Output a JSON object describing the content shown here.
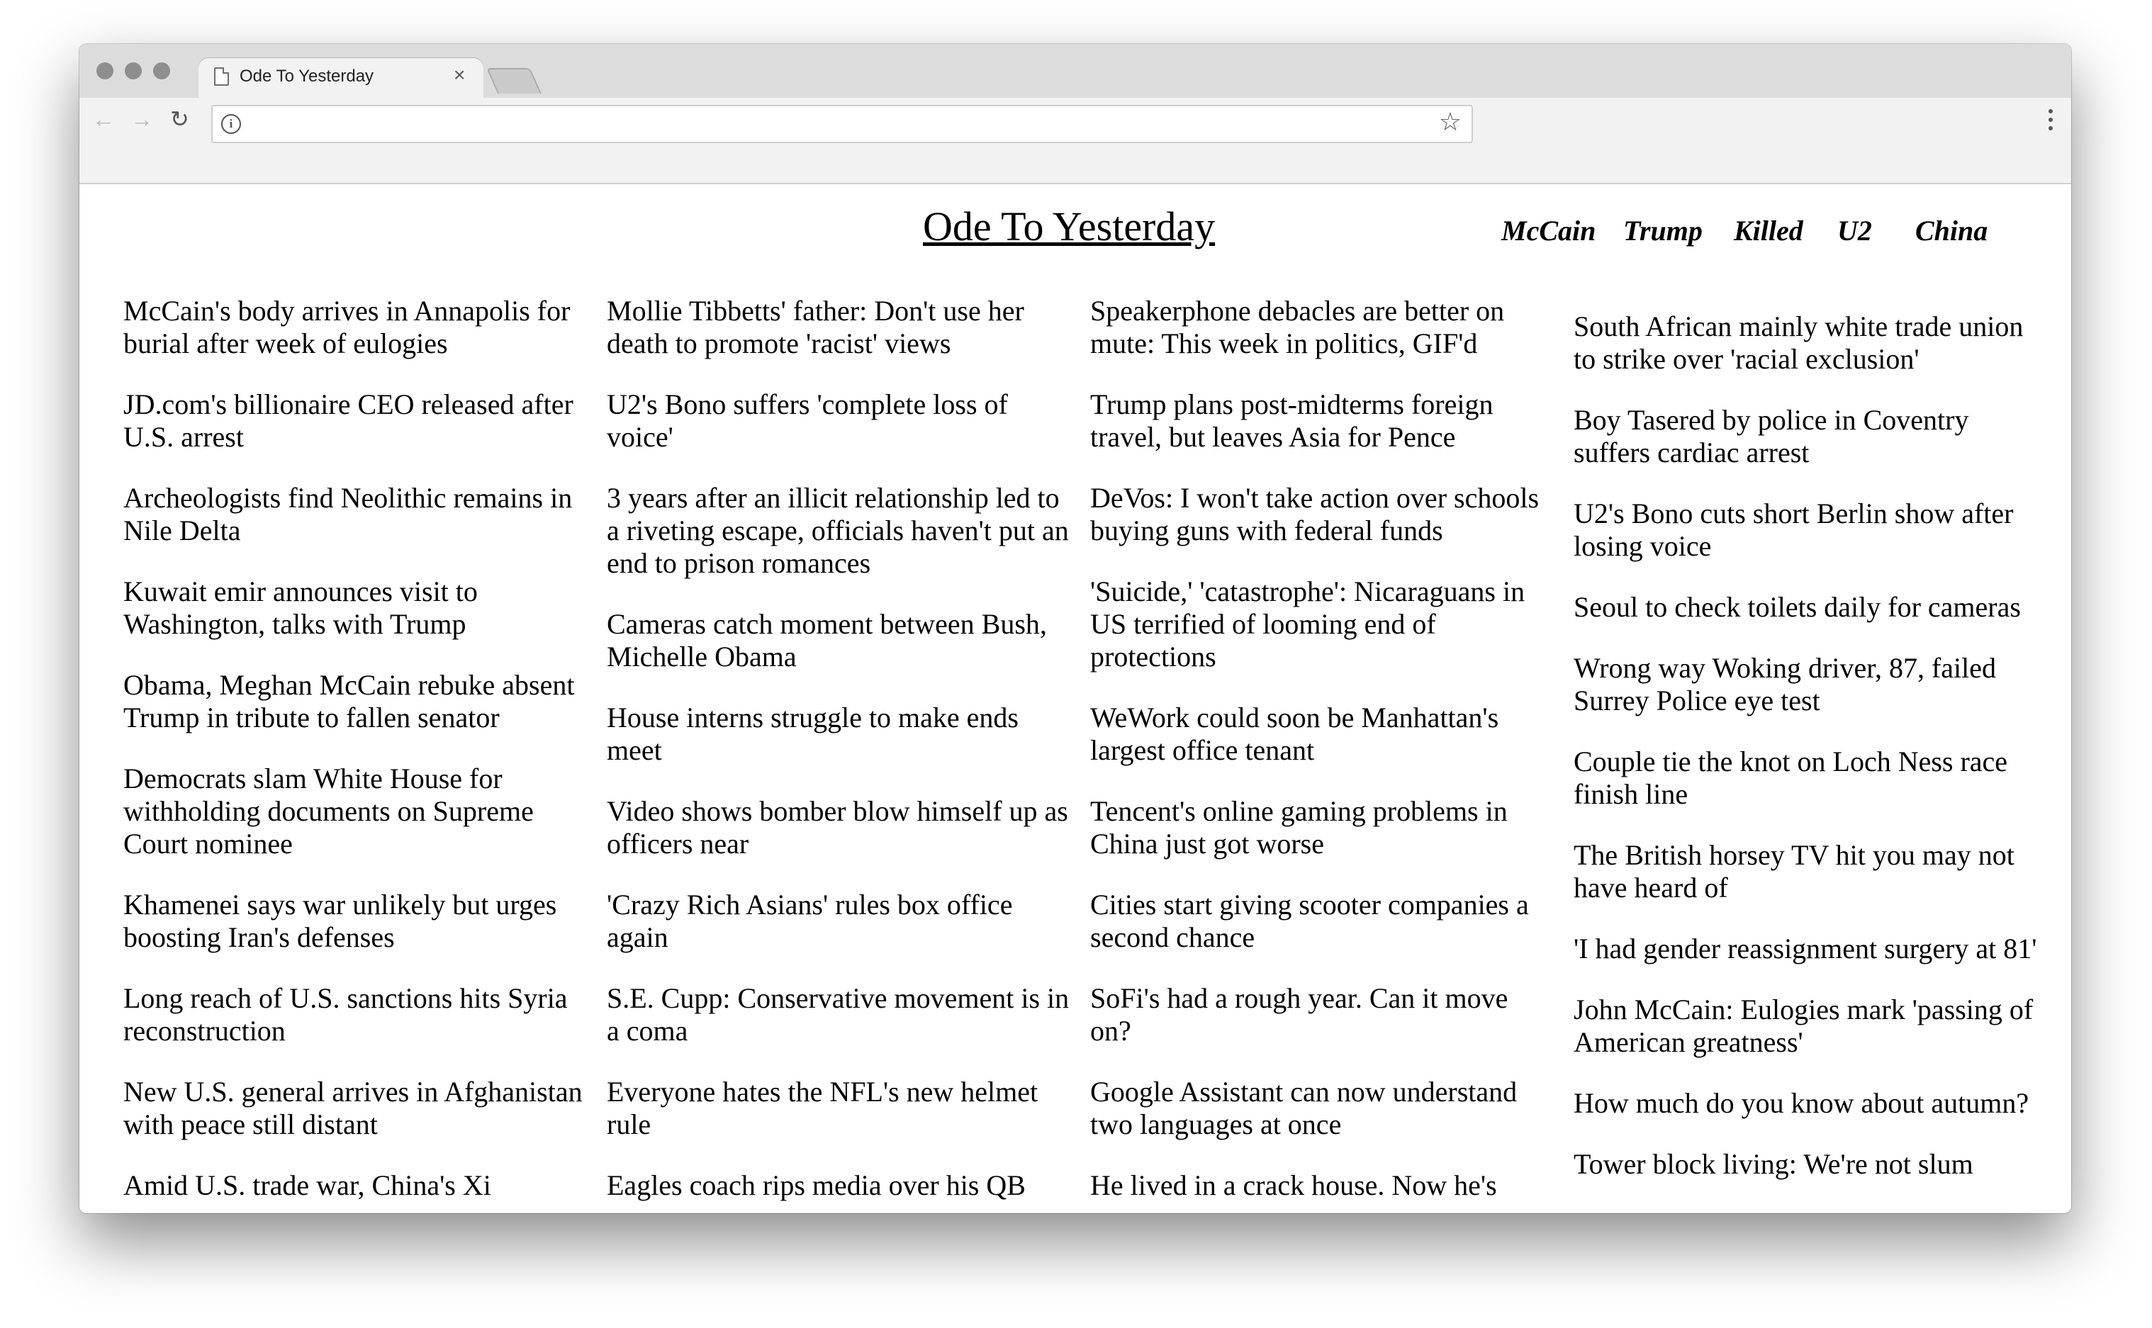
{
  "browser": {
    "tab_title": "Ode To Yesterday",
    "tab_close": "×",
    "address_value": "",
    "icons": [
      "back-arrow-icon",
      "forward-arrow-icon",
      "reload-icon",
      "info-icon",
      "star-icon",
      "menu-icon",
      "document-icon",
      "close-icon"
    ]
  },
  "site": {
    "title": "Ode To Yesterday",
    "topics": [
      "McCain",
      "Trump",
      "Killed",
      "U2",
      "China"
    ]
  },
  "columns": [
    [
      "McCain's body arrives in Annapolis for burial after week of eulogies",
      "JD.com's billionaire CEO released after U.S. arrest",
      "Archeologists find Neolithic remains in Nile Delta",
      "Kuwait emir announces visit to Washington, talks with Trump",
      "Obama, Meghan McCain rebuke absent Trump in tribute to fallen senator",
      "Democrats slam White House for withholding documents on Supreme Court nominee",
      "Khamenei says war unlikely but urges boosting Iran's defenses",
      "Long reach of U.S. sanctions hits Syria reconstruction",
      "New U.S. general arrives in Afghanistan with peace still distant",
      "Amid U.S. trade war, China's Xi"
    ],
    [
      "Mollie Tibbetts' father: Don't use her death to promote 'racist' views",
      "U2's Bono suffers 'complete loss of voice'",
      "3 years after an illicit relationship led to a riveting escape, officials haven't put an end to prison romances",
      "Cameras catch moment between Bush, Michelle Obama",
      "House interns struggle to make ends meet",
      "Video shows bomber blow himself up as officers near",
      "'Crazy Rich Asians' rules box office again",
      "S.E. Cupp: Conservative movement is in a coma",
      "Everyone hates the NFL's new helmet rule",
      "Eagles coach rips media over his QB"
    ],
    [
      "Speakerphone debacles are better on mute: This week in politics, GIF'd",
      "Trump plans post-midterms foreign travel, but leaves Asia for Pence",
      "DeVos: I won't take action over schools buying guns with federal funds",
      "'Suicide,' 'catastrophe': Nicaraguans in US terrified of looming end of protections",
      "WeWork could soon be Manhattan's largest office tenant",
      "Tencent's online gaming problems in China just got worse",
      "Cities start giving scooter companies a second chance",
      "SoFi's had a rough year. Can it move on?",
      "Google Assistant can now understand two languages at once",
      "He lived in a crack house. Now he's"
    ],
    [
      "South African mainly white trade union to strike over 'racial exclusion'",
      "Boy Tasered by police in Coventry suffers cardiac arrest",
      "U2's Bono cuts short Berlin show after losing voice",
      "Seoul to check toilets daily for cameras",
      "Wrong way Woking driver, 87, failed Surrey Police eye test",
      "Couple tie the knot on Loch Ness race finish line",
      "The British horsey TV hit you may not have heard of",
      "'I had gender reassignment surgery at 81'",
      "John McCain: Eulogies mark 'passing of American greatness'",
      "How much do you know about autumn?",
      "Tower block living: We're not slum"
    ]
  ]
}
